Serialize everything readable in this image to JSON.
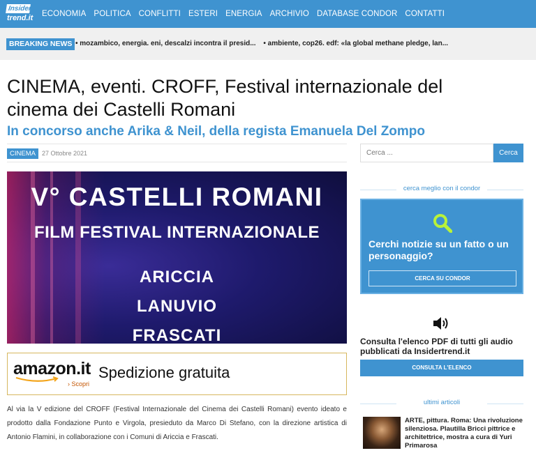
{
  "logo": {
    "top": "Insider",
    "bottom": "trend.it"
  },
  "nav": [
    "ECONOMIA",
    "POLITICA",
    "CONFLITTI",
    "ESTERI",
    "ENERGIA",
    "ARCHIVIO",
    "DATABASE CONDOR",
    "CONTATTI"
  ],
  "breaking": {
    "label": "BREAKING NEWS",
    "items": [
      "• mozambico, energia. eni, descalzi incontra il presid...",
      "• ambiente, cop26. edf: «la global methane pledge, lan..."
    ]
  },
  "article": {
    "title": "CINEMA, eventi. CROFF, Festival internazionale del cinema dei Castelli Romani",
    "subtitle": "In concorso anche Arika & Neil, della regista Emanuela Del Zompo",
    "category": "CINEMA",
    "date": "27 Ottobre 2021",
    "hero": {
      "line1": "V° CASTELLI ROMANI",
      "line2": "FILM FESTIVAL INTERNAZIONALE",
      "towns": [
        "ARICCIA",
        "LANUVIO",
        "FRASCATI"
      ]
    },
    "ad": {
      "brand": "amazon.it",
      "cta": "› Scopri",
      "text": "Spedizione gratuita"
    },
    "body": "Al via la V edizione del CROFF (Festival Internazionale del Cinema dei Castelli Romani) evento ideato e prodotto dalla Fondazione Punto e Virgola, presieduto da Marco Di Stefano, con la direzione artistica di Antonio Flamini, in collaborazione con i Comuni di Ariccia e Frascati."
  },
  "sidebar": {
    "search": {
      "placeholder": "Cerca ...",
      "button": "Cerca"
    },
    "condor_section": "cerca meglio con il condor",
    "condor_text": "Cerchi notizie su un fatto o un personaggio?",
    "condor_button": "CERCA SU CONDOR",
    "audio_text": "Consulta l'elenco PDF di tutti gli audio pubblicati da Insidertrend.it",
    "audio_button": "CONSULTA L'ELENCO",
    "latest_section": "ultimi articoli",
    "latest_post": "ARTE, pittura. Roma: Una rivoluzione silenziosa. Plautilla Bricci pittrice e architettrice, mostra a cura di Yuri Primarosa"
  },
  "colors": {
    "accent": "#3f93d0",
    "breaking_bg": "#f0f0f0"
  },
  "icons": {
    "condor": "search-icon",
    "audio": "speaker-icon"
  }
}
